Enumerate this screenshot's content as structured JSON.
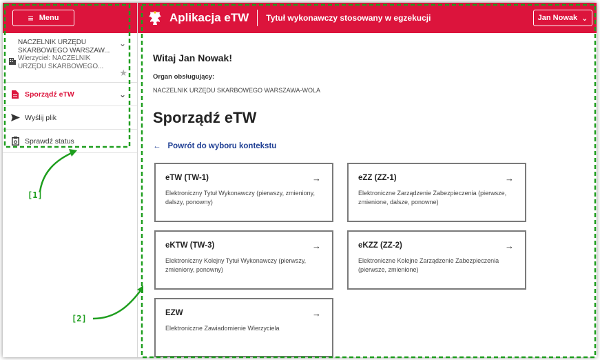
{
  "sidebar": {
    "menu_label": "Menu",
    "context": {
      "line1": "NACZELNIK URZĘDU",
      "line2": "SKARBOWEGO WARSZAW...",
      "line3": "Wierzyciel: NACZELNIK",
      "line4": "URZĘDU SKARBOWEGO..."
    },
    "items": [
      {
        "label": "Sporządź eTW",
        "icon": "document-icon",
        "active": true
      },
      {
        "label": "Wyślij plik",
        "icon": "send-icon",
        "active": false
      },
      {
        "label": "Sprawdź status",
        "icon": "clipboard-icon",
        "active": false
      }
    ]
  },
  "header": {
    "title": "Aplikacja eTW",
    "subtitle": "Tytuł wykonawczy stosowany w egzekucji",
    "user": "Jan Nowak",
    "brand_color": "#dc143c"
  },
  "main": {
    "welcome": "Witaj Jan Nowak!",
    "org_label": "Organ obsługujący:",
    "org_value": "NACZELNIK URZĘDU SKARBOWEGO WARSZAWA-WOLA",
    "page_title": "Sporządź eTW",
    "back_link": "Powrót do wyboru kontekstu",
    "cards": [
      {
        "title": "eTW (TW-1)",
        "desc": "Elektroniczny Tytuł Wykonawczy (pierwszy, zmieniony, dalszy, ponowny)"
      },
      {
        "title": "eZZ (ZZ-1)",
        "desc": "Elektroniczne Zarządzenie Zabezpieczenia (pierwsze, zmienione, dalsze, ponowne)"
      },
      {
        "title": "eKTW (TW-3)",
        "desc": "Elektroniczny Kolejny Tytuł Wykonawczy (pierwszy, zmieniony, ponowny)"
      },
      {
        "title": "eKZZ (ZZ-2)",
        "desc": "Elektroniczne Kolejne Zarządzenie Zabezpieczenia (pierwsze, zmienione)"
      },
      {
        "title": "EZW",
        "desc": "Elektroniczne Zawiadomienie Wierzyciela"
      }
    ]
  },
  "annotations": {
    "label1": "[1]",
    "label2": "[2]",
    "color": "#1e9e1e"
  }
}
